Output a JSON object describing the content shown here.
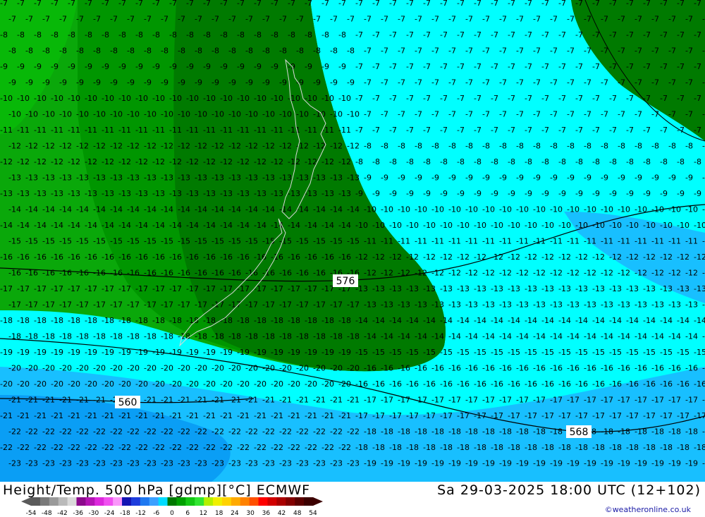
{
  "map": {
    "title": "Height/Temp. 500 hPa [gdmp][°C] ECMWF",
    "valid_time": "Sa 29-03-2025 18:00 UTC (12+102)",
    "credit": "©weatheronline.co.uk",
    "height_contour_labels": [
      "576",
      "560",
      "568"
    ],
    "temperature_contour_values": [
      "-7",
      "-8",
      "-9",
      "-10",
      "-11",
      "-12",
      "-13",
      "-14",
      "-15",
      "-16",
      "-17",
      "-18",
      "-19",
      "-20",
      "-21",
      "-22",
      "-23"
    ],
    "fill_colors": {
      "dark_green": "#007a00",
      "mid_green": "#00a000",
      "green": "#08b808",
      "cyan": "#00ffff",
      "light_blue": "#18bfff",
      "blue": "#0096ff",
      "land_outline": "#d8d8d8",
      "isotherm": "#000000",
      "height_contour": "#000000"
    }
  },
  "legend": {
    "ticks": [
      "-54",
      "-48",
      "-42",
      "-36",
      "-30",
      "-24",
      "-18",
      "-12",
      "-6",
      "0",
      "6",
      "12",
      "18",
      "24",
      "30",
      "36",
      "42",
      "48",
      "54"
    ],
    "colors": [
      "#5a5a5a",
      "#7a7a7a",
      "#9a9a9a",
      "#bababa",
      "#dadada",
      "#8c0a8c",
      "#b414b4",
      "#dc28dc",
      "#f050f0",
      "#fa96fa",
      "#1414b4",
      "#1e3cdc",
      "#1e78f0",
      "#3ca0ff",
      "#00dcff",
      "#007800",
      "#00a000",
      "#14c814",
      "#32e632",
      "#b4f000",
      "#f0f000",
      "#ffd200",
      "#ffaa00",
      "#ff8200",
      "#ff5000",
      "#ff0000",
      "#d20000",
      "#aa0000",
      "#820000",
      "#5a0000",
      "#3c0000"
    ]
  }
}
